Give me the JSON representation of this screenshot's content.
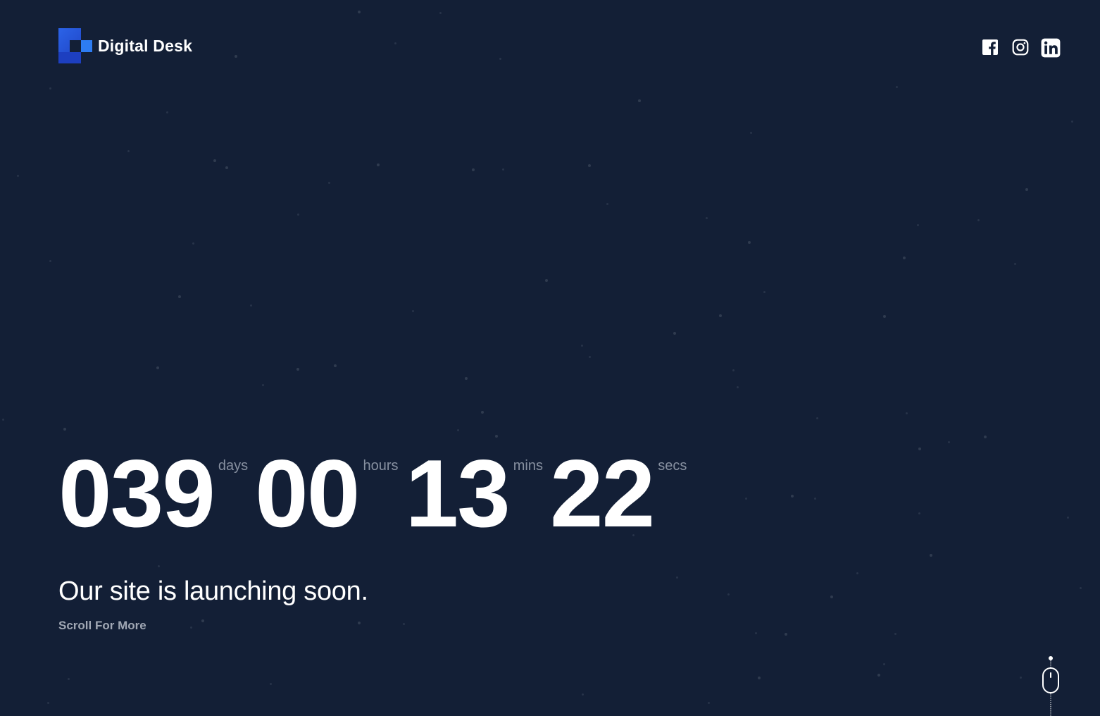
{
  "brand": {
    "name": "Digital Desk",
    "colors": {
      "background": "#131f36",
      "accent": "#2d7cf2",
      "text": "#ffffff",
      "muted": "#8790a0"
    }
  },
  "social": [
    {
      "name": "facebook",
      "icon": "facebook-icon"
    },
    {
      "name": "instagram",
      "icon": "instagram-icon"
    },
    {
      "name": "linkedin",
      "icon": "linkedin-icon"
    }
  ],
  "countdown": {
    "days": {
      "value": "039",
      "label": "days"
    },
    "hours": {
      "value": "00",
      "label": "hours"
    },
    "mins": {
      "value": "13",
      "label": "mins"
    },
    "secs": {
      "value": "22",
      "label": "secs"
    }
  },
  "tagline": "Our site is launching soon.",
  "scroll_label": "Scroll For More",
  "scroll_indicator_icon": "mouse-scroll-icon"
}
